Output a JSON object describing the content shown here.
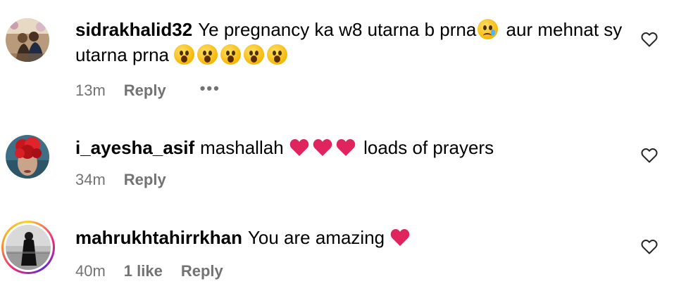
{
  "comments": [
    {
      "username": "sidrakhalid32",
      "text_1": "Ye pregnancy ka w8 utarna b prna",
      "text_2": " aur mehnat sy utarna prna ",
      "time": "13m",
      "reply_label": "Reply",
      "more_label": "•••",
      "emojis": [
        "crying-face",
        "hushed-face",
        "hushed-face",
        "hushed-face",
        "hushed-face",
        "hushed-face"
      ]
    },
    {
      "username": "i_ayesha_asif",
      "text_1": "mashallah ",
      "text_2": " loads of prayers",
      "time": "34m",
      "reply_label": "Reply",
      "emojis": [
        "red-heart",
        "red-heart",
        "red-heart"
      ]
    },
    {
      "username": "mahrukhtahirrkhan",
      "text_1": "You are amazing ",
      "time": "40m",
      "likes": "1 like",
      "reply_label": "Reply",
      "emojis": [
        "red-heart"
      ]
    }
  ],
  "colors": {
    "meta_text": "#737373",
    "heart": "#e0245e",
    "story_ring": "#ee2a7b"
  }
}
